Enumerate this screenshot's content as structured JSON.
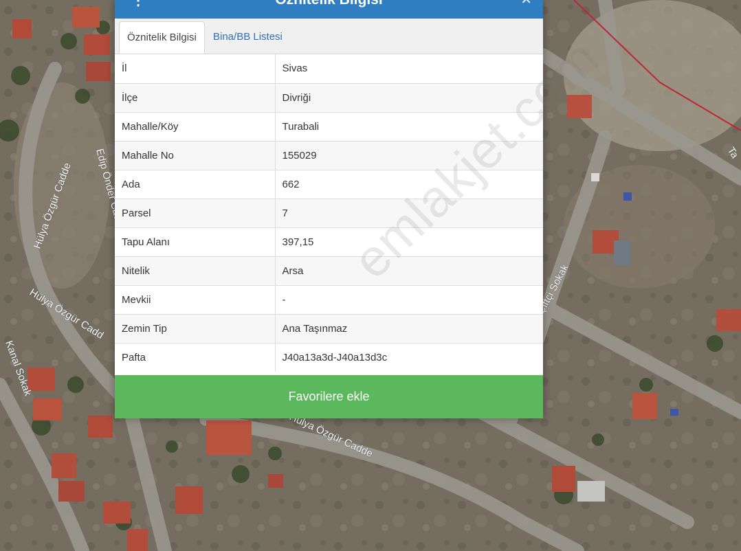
{
  "modal": {
    "title": "Öznitelik Bilgisi",
    "header_icon": "info-icon",
    "close_icon": "close-icon",
    "header_color": "#2f7ec1"
  },
  "tabs": [
    {
      "label": "Öznitelik Bilgisi",
      "active": true
    },
    {
      "label": "Bina/BB Listesi",
      "active": false
    }
  ],
  "attributes": [
    {
      "key": "İl",
      "value": "Sivas"
    },
    {
      "key": "İlçe",
      "value": "Divriği"
    },
    {
      "key": "Mahalle/Köy",
      "value": "Turabali"
    },
    {
      "key": "Mahalle No",
      "value": "155029"
    },
    {
      "key": "Ada",
      "value": "662"
    },
    {
      "key": "Parsel",
      "value": "7"
    },
    {
      "key": "Tapu Alanı",
      "value": "397,15"
    },
    {
      "key": "Nitelik",
      "value": "Arsa"
    },
    {
      "key": "Mevkii",
      "value": "-"
    },
    {
      "key": "Zemin Tip",
      "value": "Ana Taşınmaz"
    },
    {
      "key": "Pafta",
      "value": "J40a13a3d-J40a13d3c"
    }
  ],
  "favorite_button": {
    "label": "Favorilere ekle",
    "color": "#5cb85c"
  },
  "watermark": "emlakjet.com",
  "map": {
    "street_labels": [
      "Hülya Özgür Cadde",
      "Edip Önder Cadd",
      "Hülya Özgür Cadd",
      "Kanal Sokak",
      "Hülya Özgür Cadde",
      "Çiftçi Sokak",
      "Ta"
    ],
    "parcel_border_color": "#c0272d"
  }
}
